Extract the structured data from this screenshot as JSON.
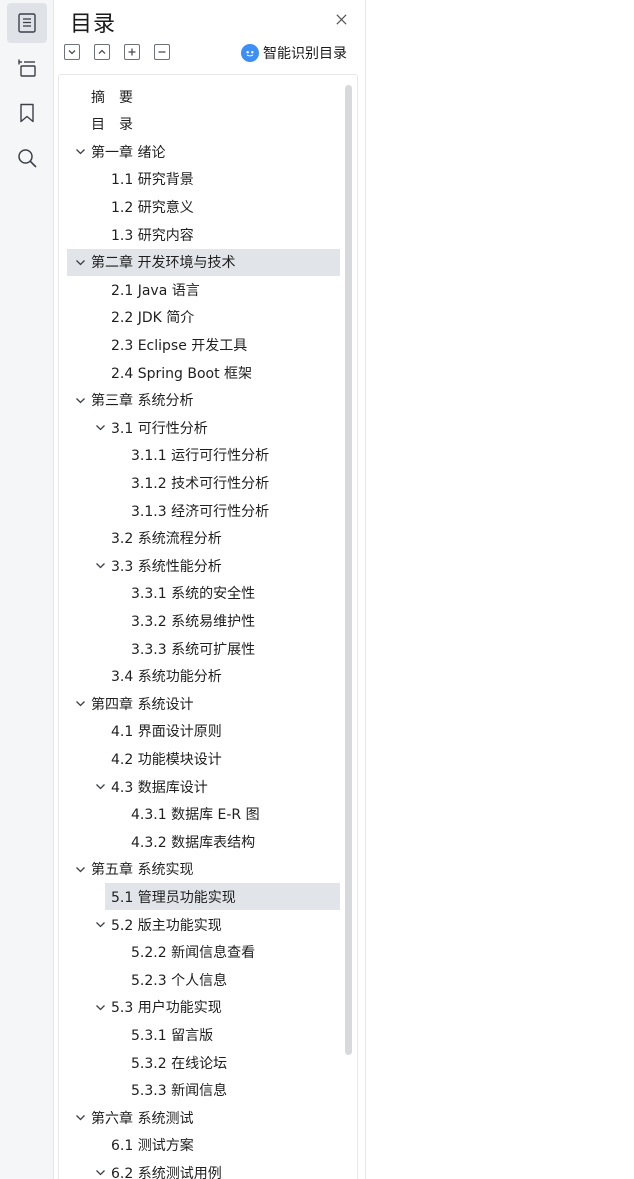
{
  "panel": {
    "title": "目录",
    "smart_toc_label": "智能识别目录"
  },
  "toc": [
    {
      "label": "摘　要",
      "level": 0,
      "has_chevron": false,
      "selected": false
    },
    {
      "label": "目　录",
      "level": 0,
      "has_chevron": false,
      "selected": false
    },
    {
      "label": "第一章  绪论",
      "level": 0,
      "has_chevron": true,
      "selected": false
    },
    {
      "label": "1.1  研究背景",
      "level": 1,
      "has_chevron": false,
      "selected": false
    },
    {
      "label": "1.2  研究意义",
      "level": 1,
      "has_chevron": false,
      "selected": false
    },
    {
      "label": "1.3  研究内容",
      "level": 1,
      "has_chevron": false,
      "selected": false
    },
    {
      "label": "第二章  开发环境与技术",
      "level": 0,
      "has_chevron": true,
      "selected": true
    },
    {
      "label": "2.1 Java 语言",
      "level": 1,
      "has_chevron": false,
      "selected": false
    },
    {
      "label": "2.2 JDK 简介",
      "level": 1,
      "has_chevron": false,
      "selected": false
    },
    {
      "label": "2.3 Eclipse 开发工具",
      "level": 1,
      "has_chevron": false,
      "selected": false
    },
    {
      "label": "2.4 Spring Boot 框架",
      "level": 1,
      "has_chevron": false,
      "selected": false
    },
    {
      "label": "第三章  系统分析",
      "level": 0,
      "has_chevron": true,
      "selected": false
    },
    {
      "label": "3.1 可行性分析",
      "level": 1,
      "has_chevron": true,
      "selected": false
    },
    {
      "label": "3.1.1 运行可行性分析",
      "level": 2,
      "has_chevron": false,
      "selected": false
    },
    {
      "label": "3.1.2 技术可行性分析",
      "level": 2,
      "has_chevron": false,
      "selected": false
    },
    {
      "label": "3.1.3 经济可行性分析",
      "level": 2,
      "has_chevron": false,
      "selected": false
    },
    {
      "label": "3.2 系统流程分析",
      "level": 1,
      "has_chevron": false,
      "selected": false
    },
    {
      "label": "3.3  系统性能分析",
      "level": 1,
      "has_chevron": true,
      "selected": false
    },
    {
      "label": "3.3.1 系统的安全性",
      "level": 2,
      "has_chevron": false,
      "selected": false
    },
    {
      "label": "3.3.2 系统易维护性",
      "level": 2,
      "has_chevron": false,
      "selected": false
    },
    {
      "label": "3.3.3 系统可扩展性",
      "level": 2,
      "has_chevron": false,
      "selected": false
    },
    {
      "label": "3.4 系统功能分析",
      "level": 1,
      "has_chevron": false,
      "selected": false
    },
    {
      "label": "第四章  系统设计",
      "level": 0,
      "has_chevron": true,
      "selected": false
    },
    {
      "label": "4.1 界面设计原则",
      "level": 1,
      "has_chevron": false,
      "selected": false
    },
    {
      "label": "4.2 功能模块设计",
      "level": 1,
      "has_chevron": false,
      "selected": false
    },
    {
      "label": "4.3 数据库设计",
      "level": 1,
      "has_chevron": true,
      "selected": false
    },
    {
      "label": "4.3.1 数据库 E-R 图",
      "level": 2,
      "has_chevron": false,
      "selected": false
    },
    {
      "label": "4.3.2  数据库表结构",
      "level": 2,
      "has_chevron": false,
      "selected": false
    },
    {
      "label": "第五章  系统实现",
      "level": 0,
      "has_chevron": true,
      "selected": false
    },
    {
      "label": "5.1  管理员功能实现",
      "level": 1,
      "has_chevron": false,
      "selected": true
    },
    {
      "label": "5.2  版主功能实现",
      "level": 1,
      "has_chevron": true,
      "selected": false
    },
    {
      "label": "5.2.2  新闻信息查看",
      "level": 2,
      "has_chevron": false,
      "selected": false
    },
    {
      "label": "5.2.3  个人信息",
      "level": 2,
      "has_chevron": false,
      "selected": false
    },
    {
      "label": "5.3  用户功能实现",
      "level": 1,
      "has_chevron": true,
      "selected": false
    },
    {
      "label": "5.3.1  留言版",
      "level": 2,
      "has_chevron": false,
      "selected": false
    },
    {
      "label": "5.3.2  在线论坛",
      "level": 2,
      "has_chevron": false,
      "selected": false
    },
    {
      "label": "5.3.3  新闻信息",
      "level": 2,
      "has_chevron": false,
      "selected": false
    },
    {
      "label": "第六章  系统测试",
      "level": 0,
      "has_chevron": true,
      "selected": false
    },
    {
      "label": "6.1  测试方案",
      "level": 1,
      "has_chevron": false,
      "selected": false
    },
    {
      "label": "6.2  系统测试用例",
      "level": 1,
      "has_chevron": true,
      "selected": false
    }
  ]
}
